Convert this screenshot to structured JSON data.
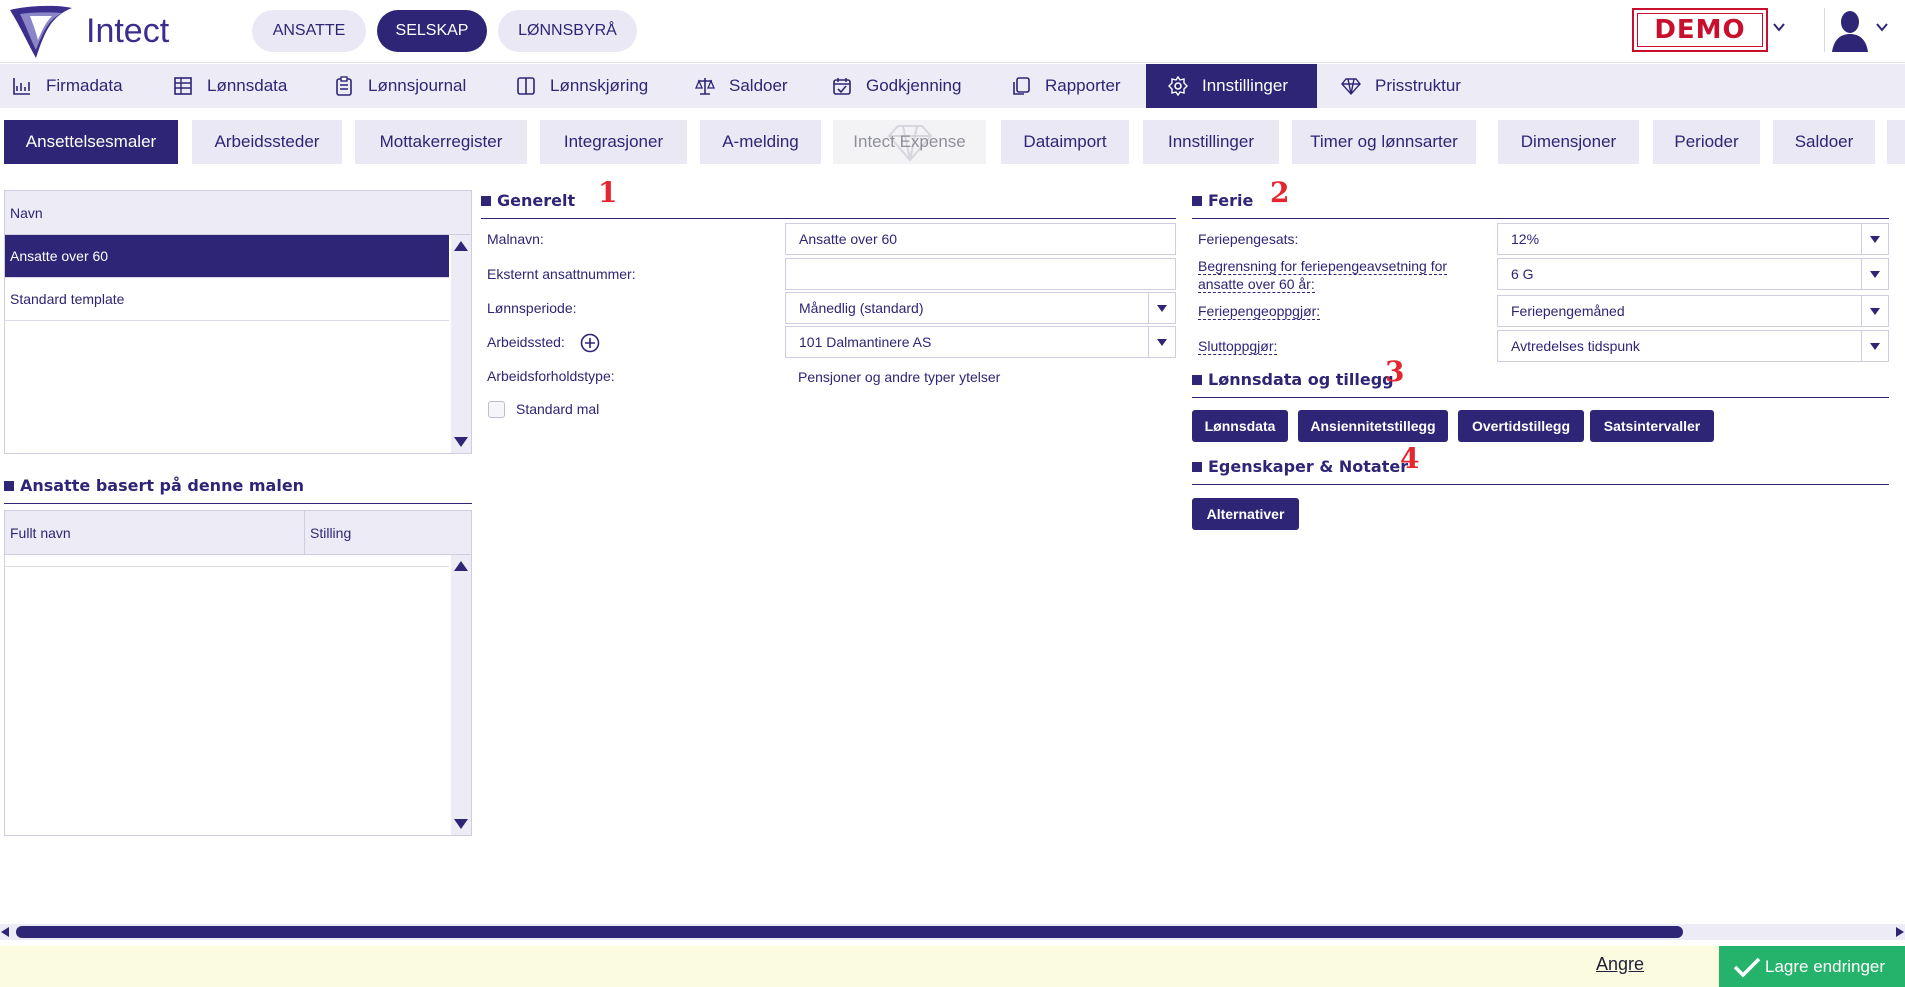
{
  "brand": {
    "name": "Intect",
    "color": "#2e2576",
    "demo_label": "DEMO",
    "demo_color": "#c8102e"
  },
  "top_pills": [
    {
      "label": "ANSATTE",
      "active": false
    },
    {
      "label": "SELSKAP",
      "active": true
    },
    {
      "label": "LØNNSBYRÅ",
      "active": false
    }
  ],
  "main_nav": [
    {
      "label": "Firmadata",
      "icon": "chart-icon"
    },
    {
      "label": "Lønnsdata",
      "icon": "table-icon"
    },
    {
      "label": "Lønnsjournal",
      "icon": "clipboard-icon"
    },
    {
      "label": "Lønnskjøring",
      "icon": "book-icon"
    },
    {
      "label": "Saldoer",
      "icon": "scale-icon"
    },
    {
      "label": "Godkjenning",
      "icon": "calendar-check-icon"
    },
    {
      "label": "Rapporter",
      "icon": "copy-icon"
    },
    {
      "label": "Innstillinger",
      "icon": "gear-icon",
      "active": true
    },
    {
      "label": "Prisstruktur",
      "icon": "diamond-icon"
    }
  ],
  "sub_tabs": [
    {
      "label": "Ansettelsesmaler",
      "active": true
    },
    {
      "label": "Arbeidssteder"
    },
    {
      "label": "Mottakerregister"
    },
    {
      "label": "Integrasjoner"
    },
    {
      "label": "A-melding"
    },
    {
      "label": "Intect Expense",
      "disabled": true
    },
    {
      "label": "Dataimport"
    },
    {
      "label": "Innstillinger"
    },
    {
      "label": "Timer og lønnsarter"
    },
    {
      "label": "Dimensjoner"
    },
    {
      "label": "Perioder"
    },
    {
      "label": "Saldoer"
    }
  ],
  "template_list": {
    "header": "Navn",
    "rows": [
      "Ansatte over 60",
      "Standard template"
    ],
    "selected_index": 0
  },
  "employees_section": {
    "title": "Ansatte basert på denne malen",
    "columns": [
      "Fullt navn",
      "Stilling"
    ]
  },
  "general": {
    "title": "Generelt",
    "number": "1",
    "fields": {
      "malnavn_label": "Malnavn:",
      "malnavn_value": "Ansatte over 60",
      "ekstern_label": "Eksternt ansattnummer:",
      "ekstern_value": "",
      "periode_label": "Lønnsperiode:",
      "periode_value": "Månedlig (standard)",
      "arbeidssted_label": "Arbeidssted:",
      "arbeidssted_value": "101 Dalmantinere AS",
      "forhold_label": "Arbeidsforholdstype:",
      "forhold_value": "Pensjoner og andre typer ytelser",
      "standard_label": "Standard mal"
    }
  },
  "ferie": {
    "title": "Ferie",
    "number": "2",
    "fields": {
      "sats_label": "Feriepengesats:",
      "sats_value": "12%",
      "begrensning_label_1": "Begrensning for feriepengeavsetning for",
      "begrensning_label_2": "ansatte over 60 år:",
      "begrensning_value": "6 G",
      "oppgjor_label": "Feriepengeoppgjør:",
      "oppgjor_value": "Feriepengemåned",
      "slutt_label": "Sluttoppgjør:",
      "slutt_value": "Avtredelses tidspunk"
    }
  },
  "lonnsdata": {
    "title": "Lønnsdata og tillegg",
    "number": "3",
    "buttons": [
      "Lønnsdata",
      "Ansiennitetstillegg",
      "Overtidstillegg",
      "Satsintervaller"
    ]
  },
  "egenskaper": {
    "title": "Egenskaper & Notater",
    "number": "4",
    "button": "Alternativer"
  },
  "footer": {
    "undo": "Angre",
    "save": "Lagre endringer",
    "save_color": "#25b36b",
    "bg_color": "#fbfbdf"
  }
}
